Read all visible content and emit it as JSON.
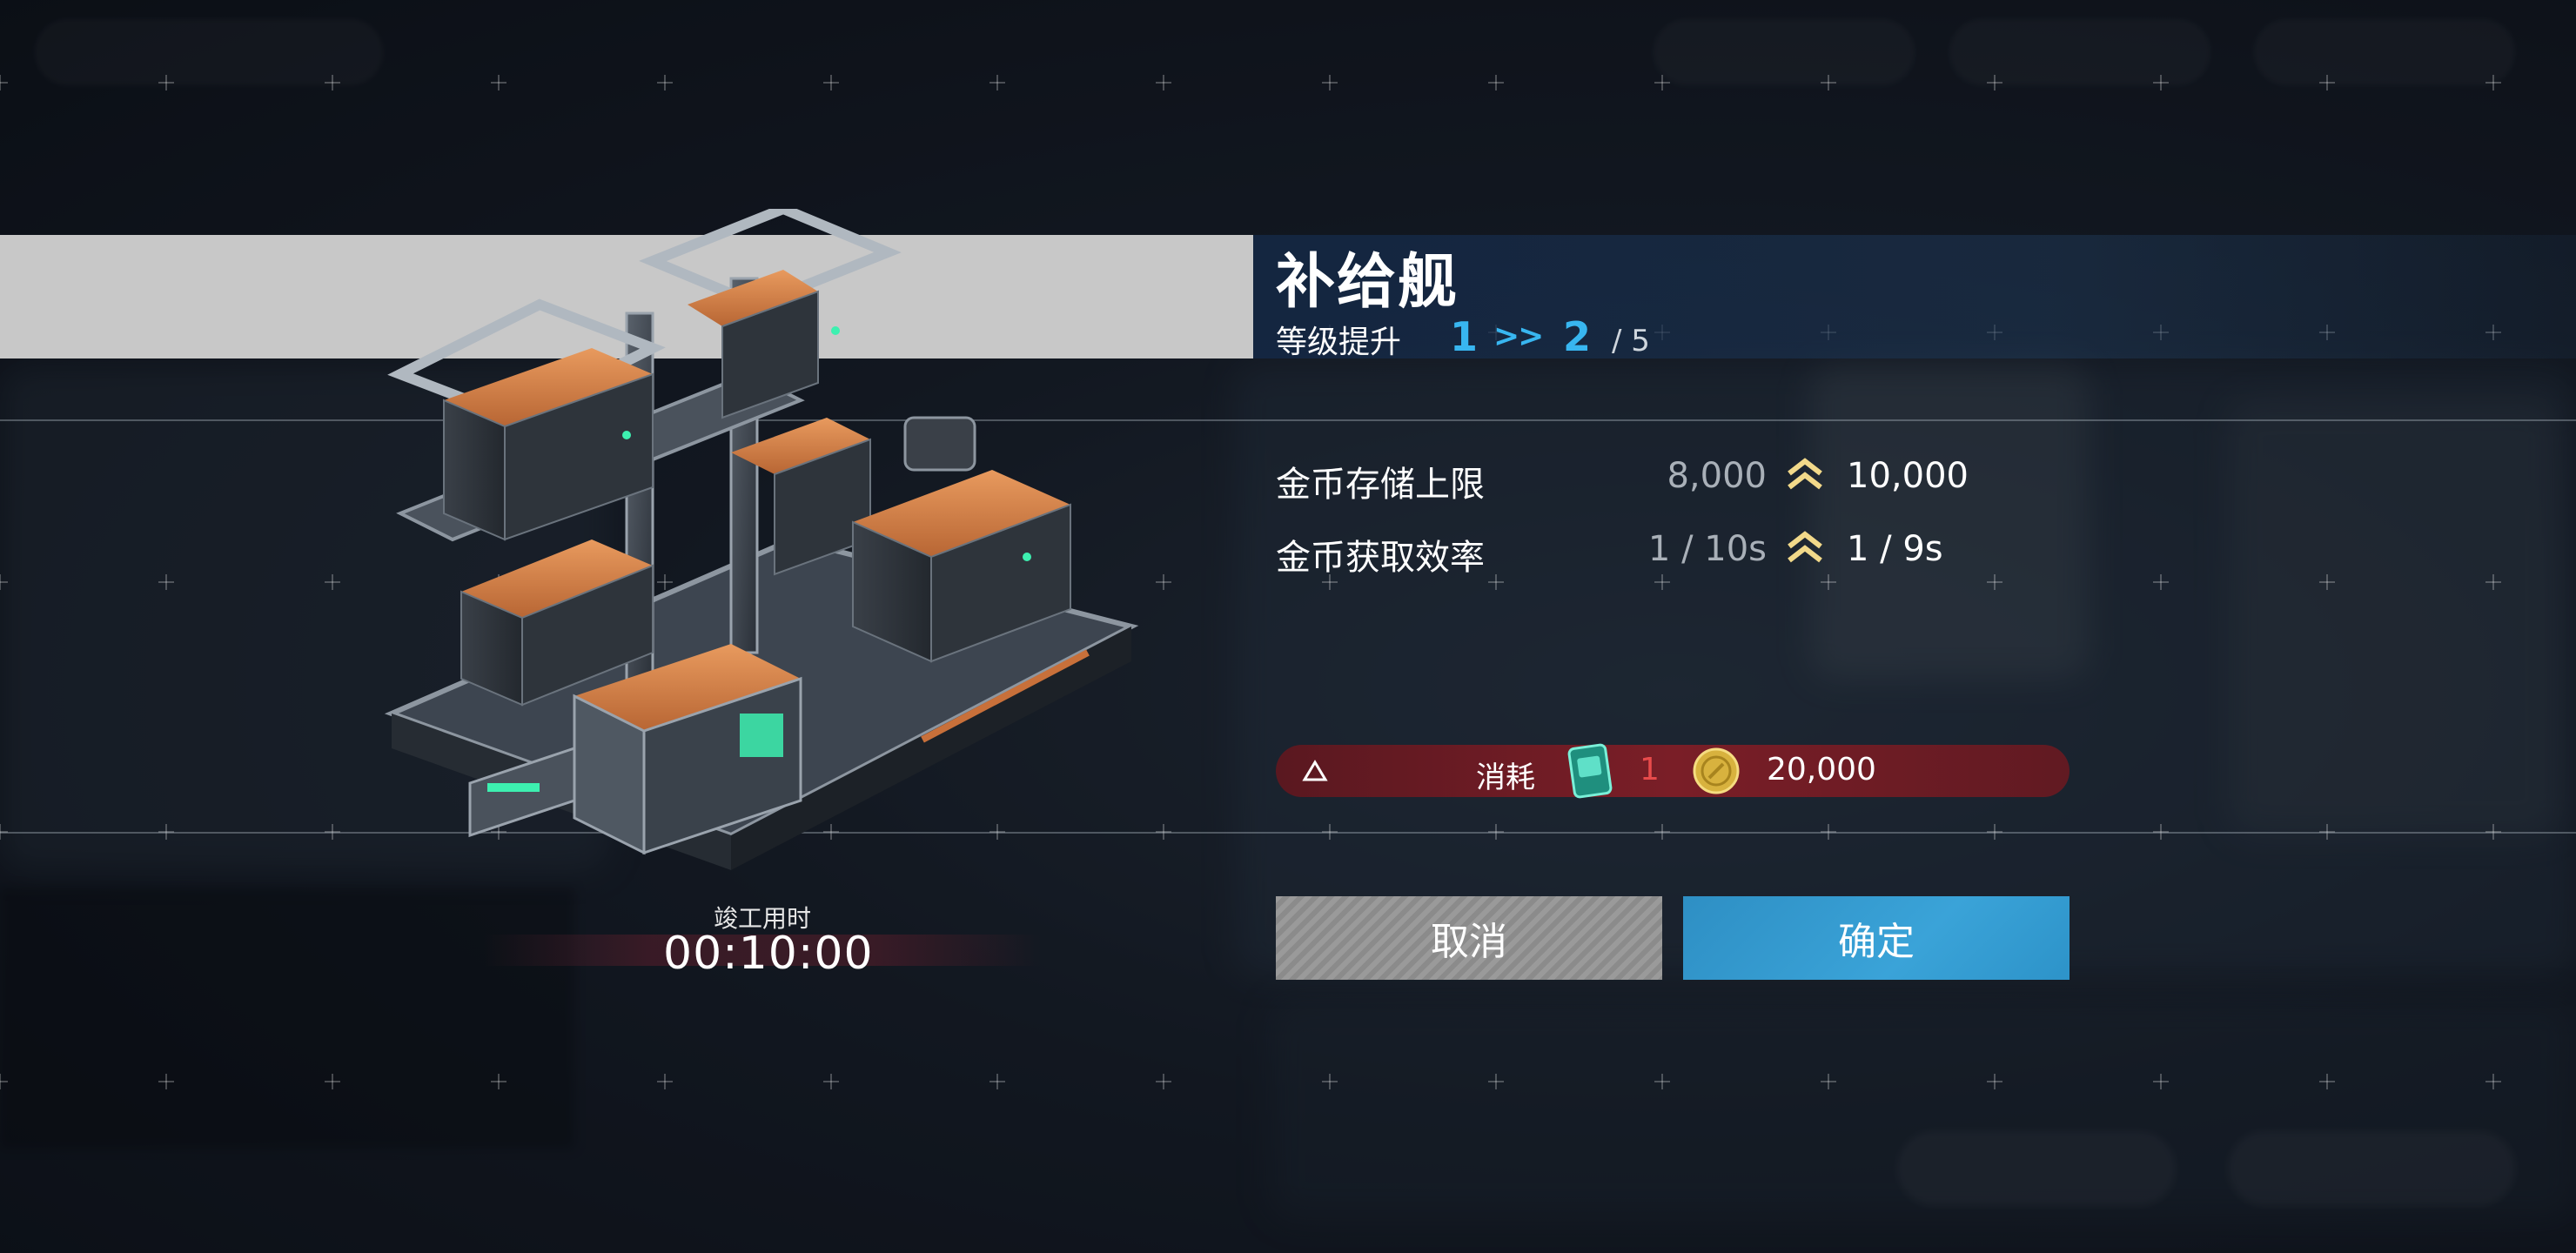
{
  "dialog": {
    "title": "补给舰",
    "level": {
      "label": "等级提升",
      "from": "1",
      "arrow": ">>",
      "to": "2",
      "max": "/ 5"
    },
    "stats": [
      {
        "label": "金币存储上限",
        "old": "8,000",
        "new": "10,000"
      },
      {
        "label": "金币获取效率",
        "old": "1 / 10s",
        "new": "1 / 9s"
      }
    ],
    "cost": {
      "label": "消耗",
      "ticket_icon": "upgrade-ticket-icon",
      "ticket_count": "1",
      "coin_icon": "gold-coin-icon",
      "coin_amount": "20,000"
    },
    "buttons": {
      "cancel": "取消",
      "confirm": "确定"
    },
    "build_time": {
      "label": "竣工用时",
      "value": "00:10:00"
    }
  },
  "colors": {
    "accent_blue": "#38b6f0",
    "cost_bar": "#7a1e27",
    "confirm_button": "#3aa3d8",
    "cancel_button": "#8f8f8f",
    "warn_red": "#e84b4b",
    "chevron_gold": "#f2d98a"
  }
}
